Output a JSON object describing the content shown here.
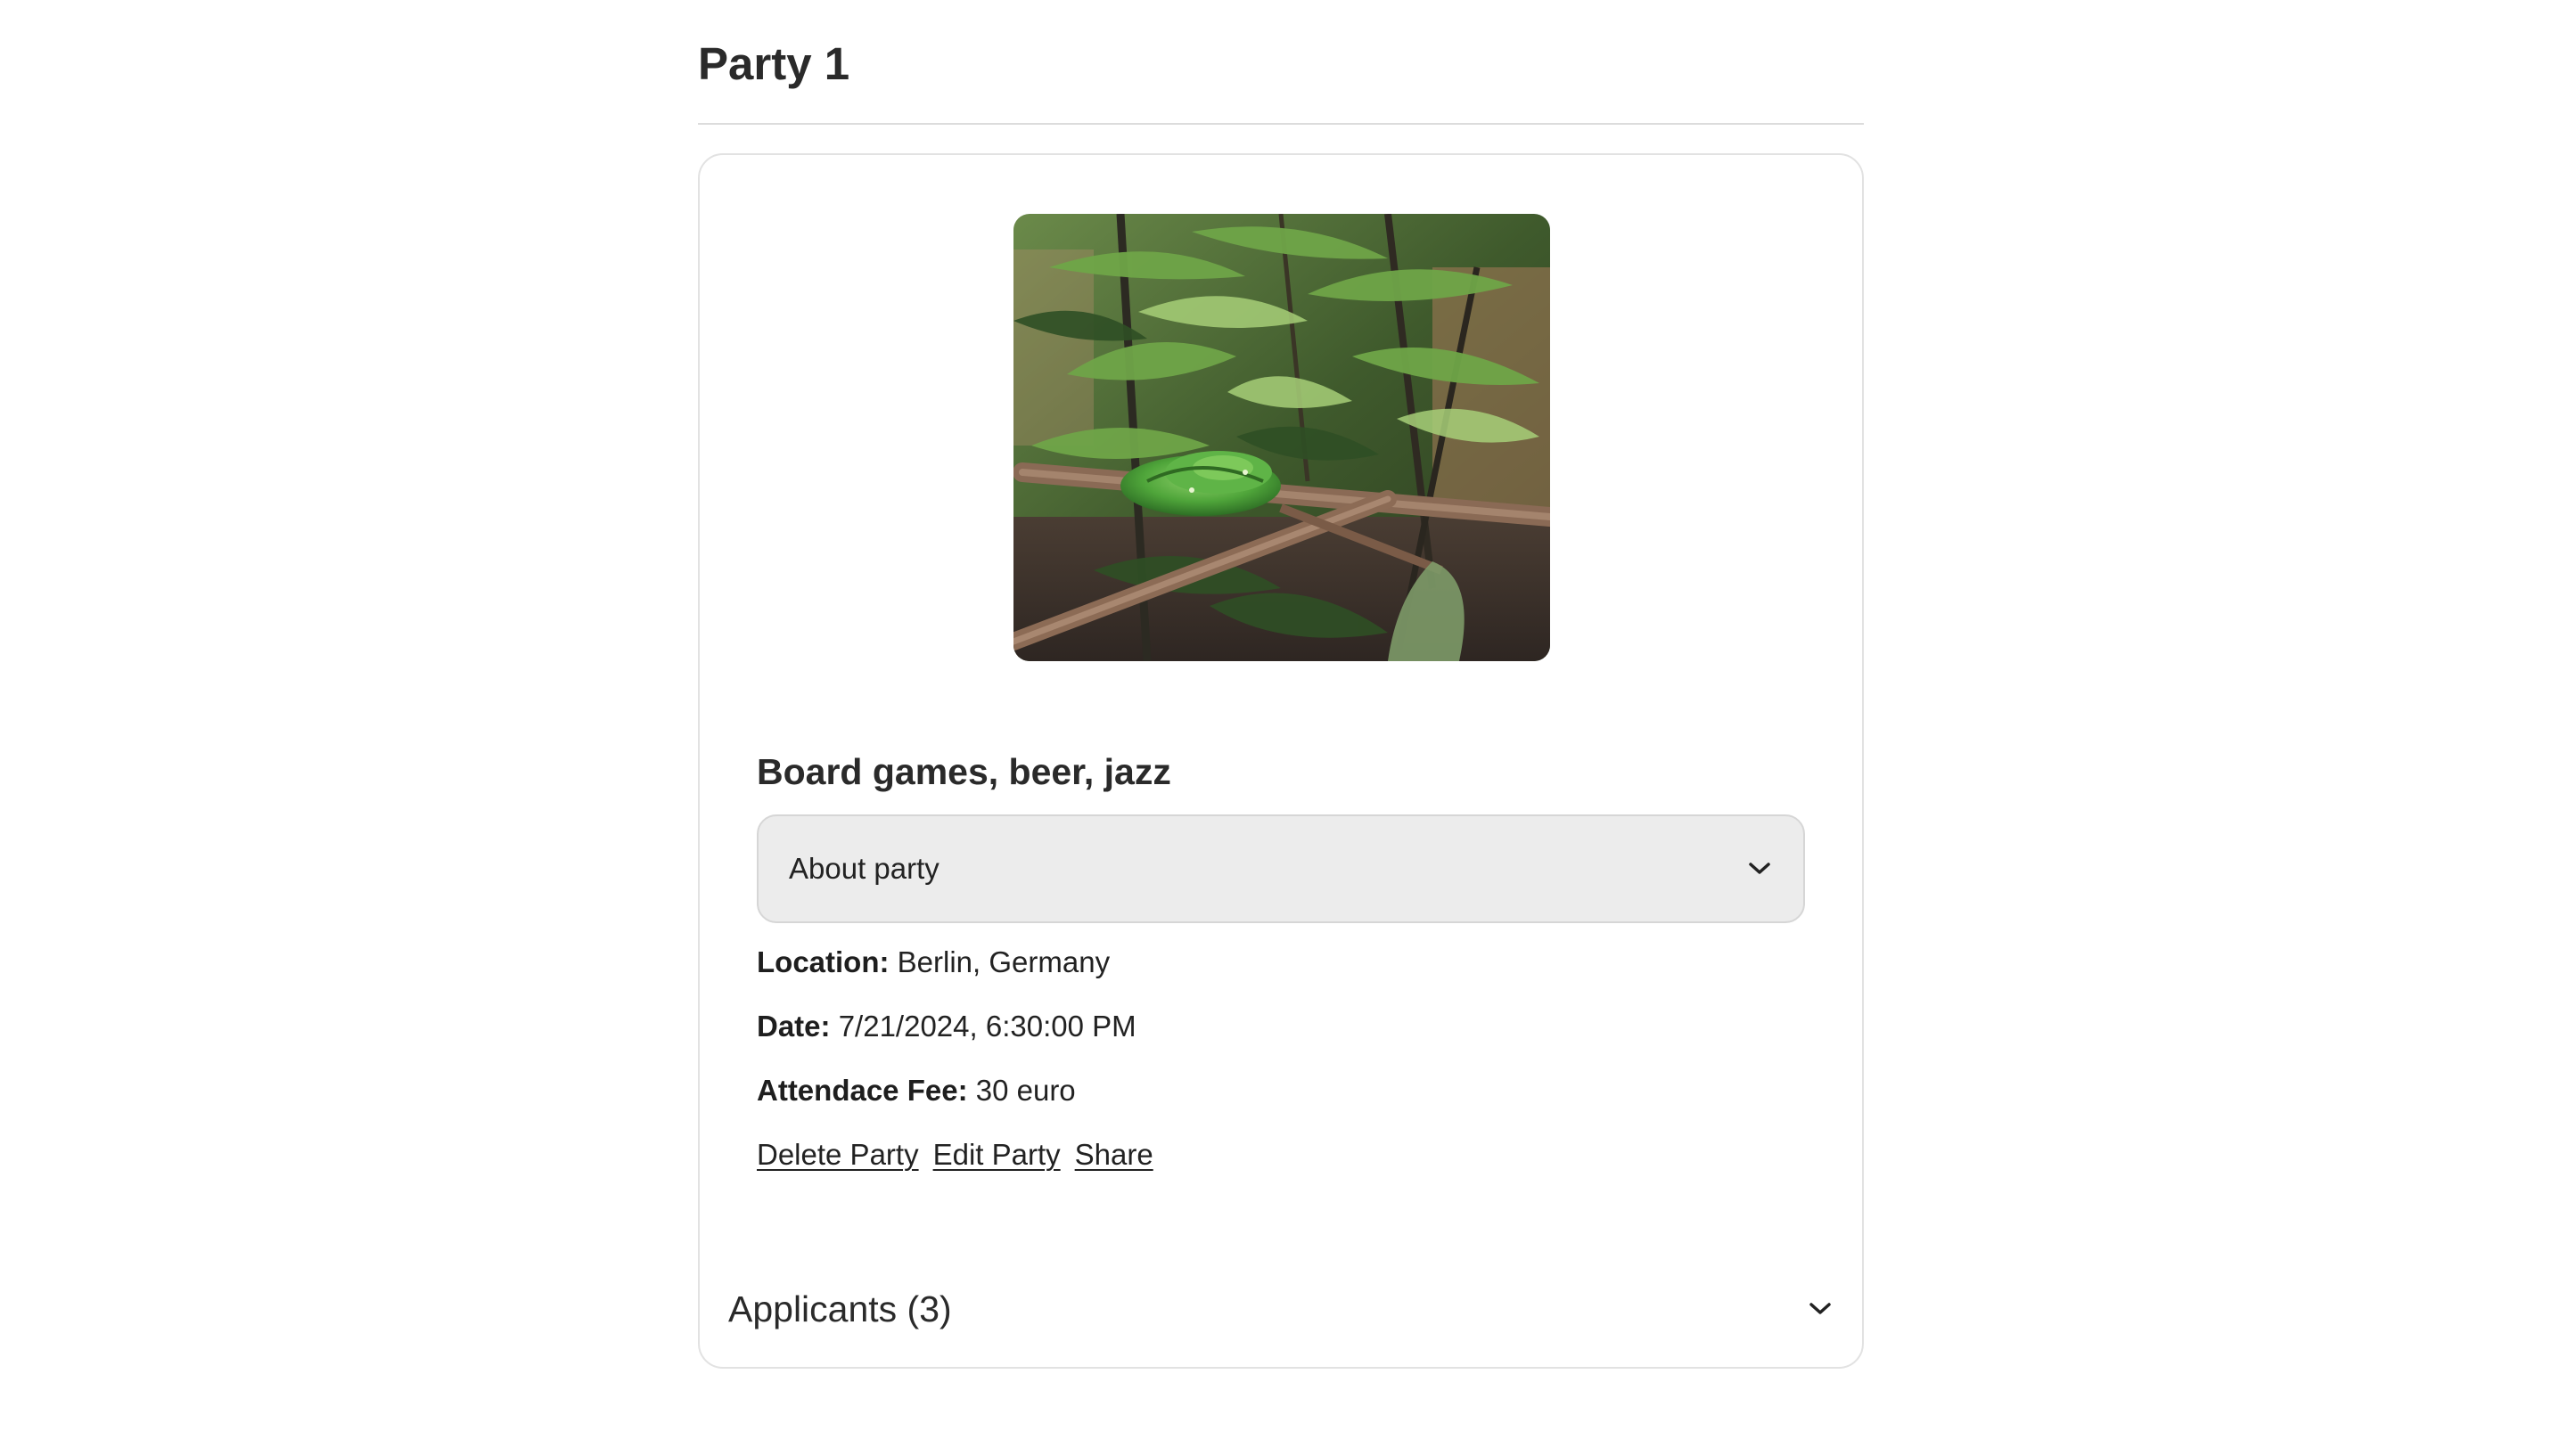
{
  "page": {
    "title": "Party 1"
  },
  "party": {
    "image_alt": "Green snake coiled on a branch among bamboo leaves",
    "heading": "Board games, beer, jazz",
    "about_label": "About party",
    "location_label": "Location:",
    "location_value": "Berlin, Germany",
    "date_label": "Date:",
    "date_value": "7/21/2024, 6:30:00 PM",
    "fee_label": "Attendace Fee:",
    "fee_value": "30 euro"
  },
  "actions": {
    "delete": "Delete Party",
    "edit": "Edit Party",
    "share": "Share"
  },
  "applicants": {
    "label": "Applicants (3)"
  },
  "icons": {
    "about_toggle": "chevron-down-icon",
    "applicants_toggle": "chevron-down-icon"
  },
  "colors": {
    "dropdown_bg": "#ececec",
    "card_border": "#e2e2e2",
    "text": "#222222"
  }
}
